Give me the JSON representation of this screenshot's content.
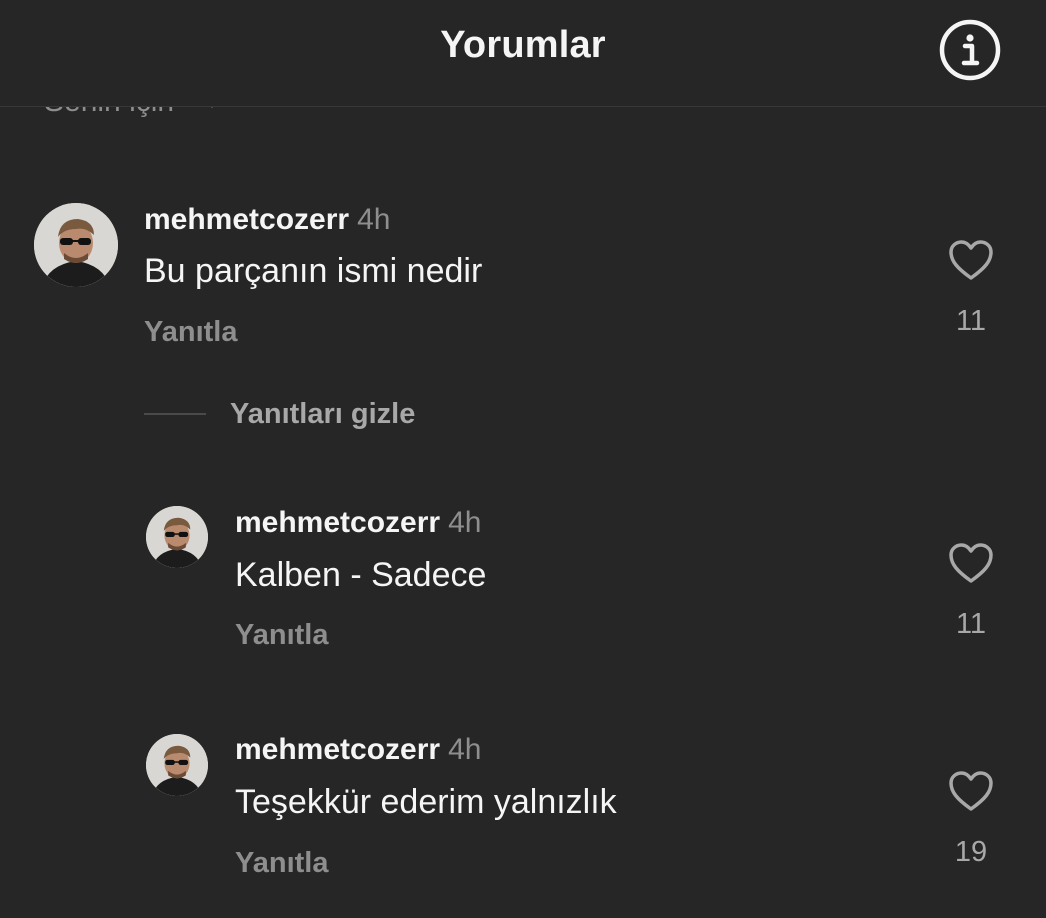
{
  "header": {
    "title": "Yorumlar",
    "info_icon": "info-circle-icon"
  },
  "sort": {
    "label": "Senin için",
    "icon": "chevron-down-icon"
  },
  "comments": [
    {
      "username": "mehmetcozerr",
      "time": "4h",
      "text": "Bu parçanın ismi nedir",
      "reply_label": "Yanıtla",
      "likes": "11",
      "like_icon": "heart-outline-icon"
    }
  ],
  "replies_toggle": {
    "label": "Yanıtları gizle"
  },
  "replies": [
    {
      "username": "mehmetcozerr",
      "time": "4h",
      "text": "Kalben - Sadece",
      "reply_label": "Yanıtla",
      "likes": "11",
      "like_icon": "heart-outline-icon"
    },
    {
      "username": "mehmetcozerr",
      "time": "4h",
      "text": "Teşekkür ederim yalnızlık",
      "reply_label": "Yanıtla",
      "likes": "19",
      "like_icon": "heart-outline-icon"
    }
  ],
  "colors": {
    "background": "#262626",
    "primary_text": "#f5f5f5",
    "secondary_text": "#8e8e8e",
    "divider": "#383838"
  }
}
